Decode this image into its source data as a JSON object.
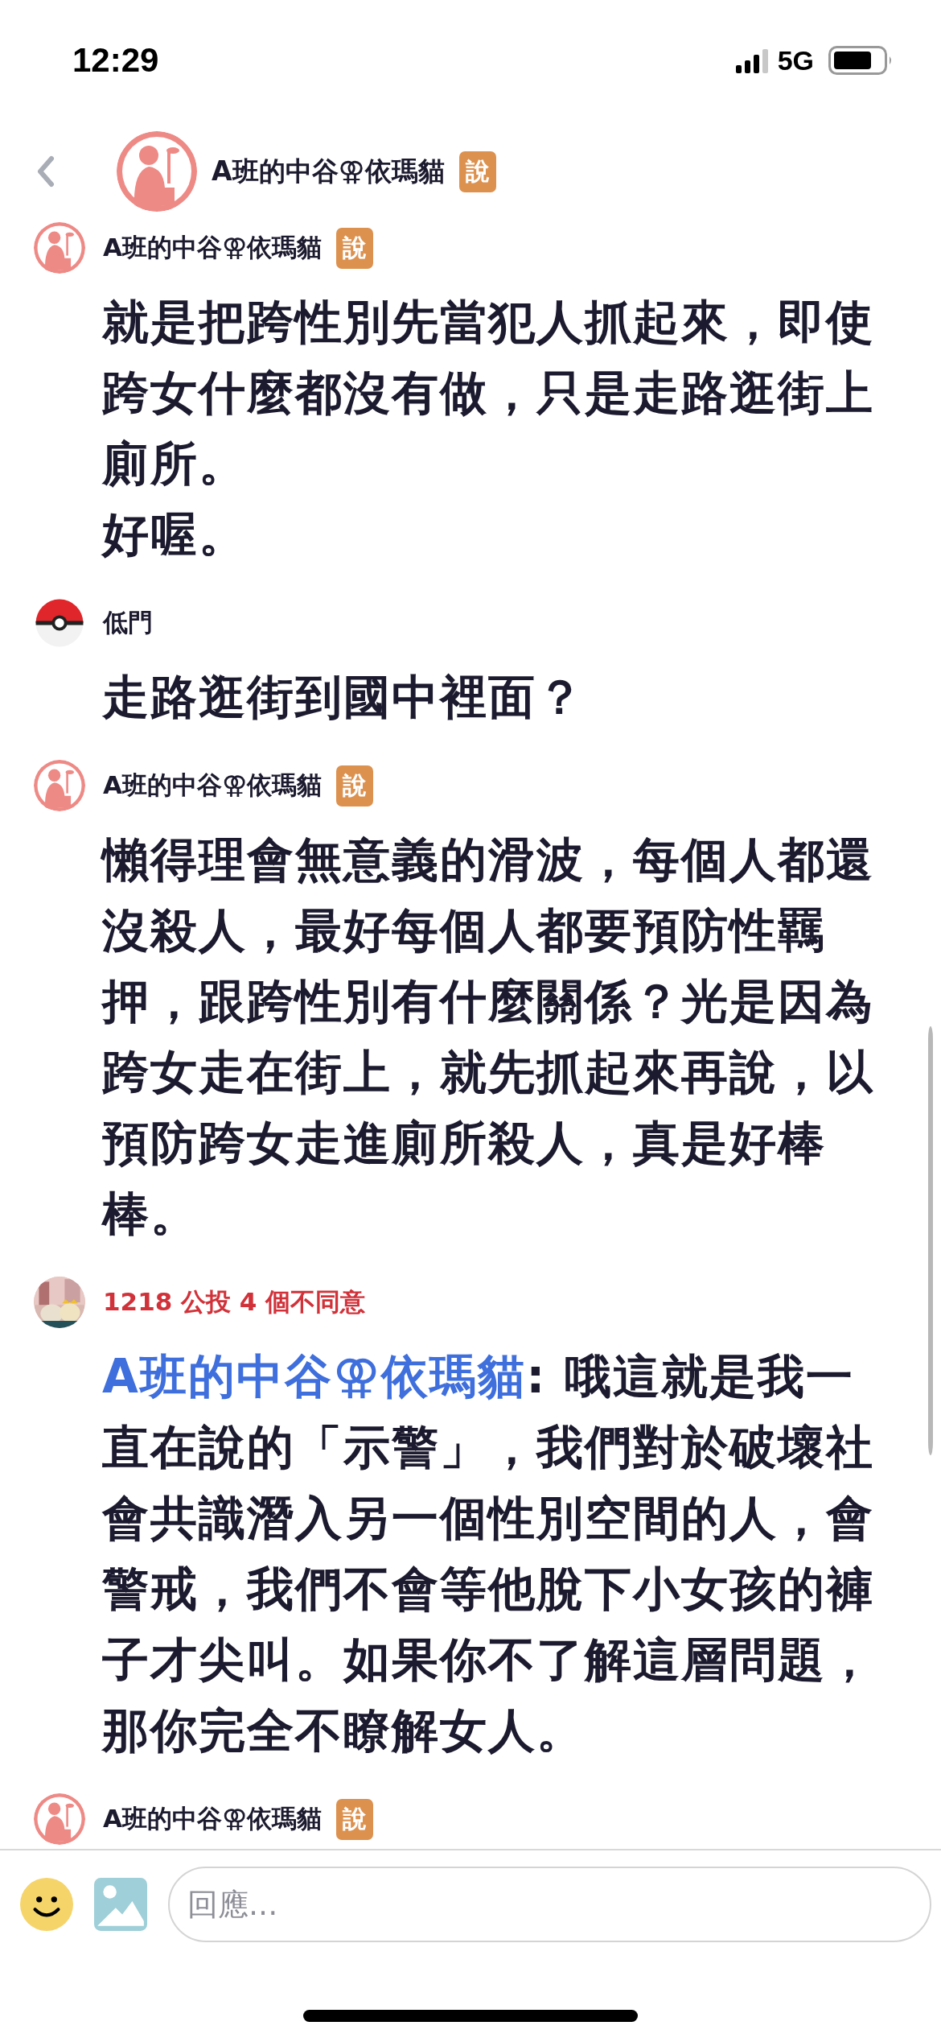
{
  "status_bar": {
    "time": "12:29",
    "network": "5G"
  },
  "header": {
    "title": "A班的中谷⚢依瑪貓",
    "badge": "說"
  },
  "messages": [
    {
      "author": "A班的中谷⚢依瑪貓",
      "color": "#1c1a2e",
      "badge": "說",
      "text": "就是把跨性別先當犯人抓起來，即使跨女什麼都沒有做，只是走路逛街上廁所。",
      "text_2": "好喔。"
    },
    {
      "author": "低門",
      "color": "#1c1a2e",
      "text": "走路逛街到國中裡面？"
    },
    {
      "author": "A班的中谷⚢依瑪貓",
      "color": "#1c1a2e",
      "badge": "說",
      "text": "懶得理會無意義的滑波，每個人都還沒殺人，最好每個人都要預防性羈押，跟跨性別有什麼關係？光是因為跨女走在街上，就先抓起來再說，以預防跨女走進廁所殺人，真是好棒棒。"
    },
    {
      "author": "1218 公投 4 個不同意",
      "color": "#d1323a",
      "mention": "A班的中谷⚢依瑪貓",
      "text": ": 哦這就是我一直在說的「示警」，我們對於破壞社會共識潛入另一個性別空間的人，會警戒，我們不會等他脫下小女孩的褲子才尖叫。如果你不了解這層問題，那你完全不瞭解女人。"
    },
    {
      "author": "A班的中谷⚢依瑪貓",
      "color": "#1c1a2e",
      "badge": "說"
    }
  ],
  "composer": {
    "placeholder": "回應..."
  }
}
